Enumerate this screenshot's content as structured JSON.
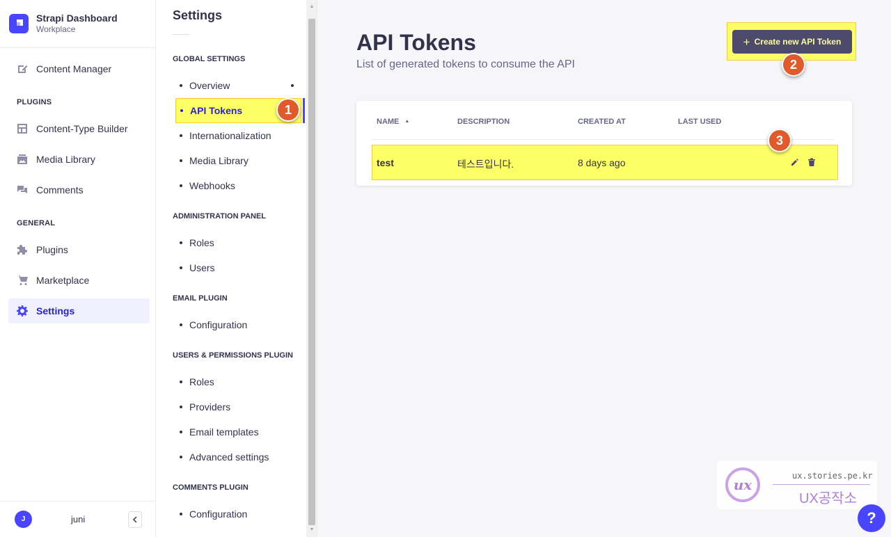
{
  "brand": {
    "title": "Strapi Dashboard",
    "subtitle": "Workplace"
  },
  "mainnav": {
    "content_manager": "Content Manager",
    "plugins_section": "PLUGINS",
    "content_type_builder": "Content-Type Builder",
    "media_library": "Media Library",
    "comments": "Comments",
    "general_section": "GENERAL",
    "plugins": "Plugins",
    "marketplace": "Marketplace",
    "settings": "Settings"
  },
  "user": {
    "initial": "J",
    "name": "juni"
  },
  "subnav": {
    "title": "Settings",
    "global_section": "GLOBAL SETTINGS",
    "global_items": [
      "Overview",
      "API Tokens",
      "Internationalization",
      "Media Library",
      "Webhooks"
    ],
    "admin_section": "ADMINISTRATION PANEL",
    "admin_items": [
      "Roles",
      "Users"
    ],
    "email_section": "EMAIL PLUGIN",
    "email_items": [
      "Configuration"
    ],
    "users_section": "USERS & PERMISSIONS PLUGIN",
    "users_items": [
      "Roles",
      "Providers",
      "Email templates",
      "Advanced settings"
    ],
    "comments_section": "COMMENTS PLUGIN",
    "comments_items": [
      "Configuration"
    ]
  },
  "page": {
    "title": "API Tokens",
    "subtitle": "List of generated tokens to consume the API",
    "create_button": "Create new API Token"
  },
  "table": {
    "headers": {
      "name": "NAME",
      "description": "DESCRIPTION",
      "created_at": "CREATED AT",
      "last_used": "LAST USED"
    },
    "rows": [
      {
        "name": "test",
        "description": "테스트입니다.",
        "created_at": "8 days ago",
        "last_used": ""
      }
    ]
  },
  "annotations": {
    "badge1": "1",
    "badge2": "2",
    "badge3": "3"
  },
  "watermark": {
    "logo": "ux",
    "url": "ux.stories.pe.kr",
    "name": "UX공작소"
  },
  "help": {
    "label": "?"
  },
  "colors": {
    "primary": "#4945ff",
    "highlight": "#ffff66",
    "badge": "#e05a2b"
  }
}
